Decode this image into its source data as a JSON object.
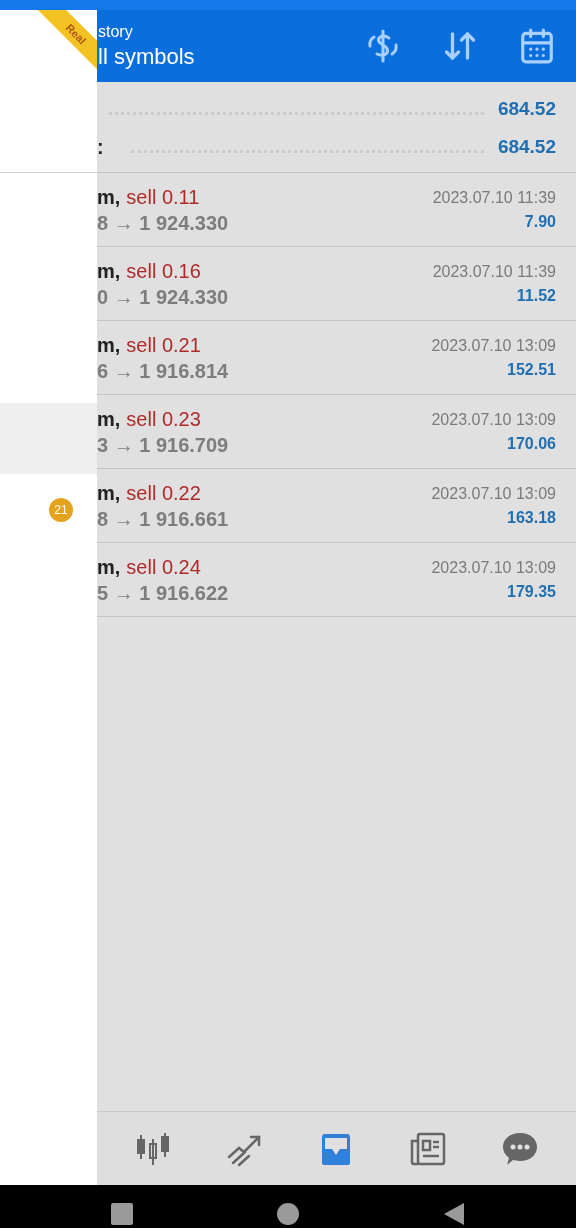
{
  "drawer": {
    "account_badge": "Real",
    "items": [
      {
        "selected": true
      },
      {
        "selected": false,
        "badge": "21"
      }
    ]
  },
  "header": {
    "title": "story",
    "subtitle": "ll symbols"
  },
  "summary": [
    {
      "value": "684.52"
    },
    {
      "label": ":",
      "value": "684.52"
    }
  ],
  "deals": [
    {
      "symbol": "m,",
      "side": "sell 0.11",
      "prices": "8 → 1 924.330",
      "time": "2023.07.10 11:39",
      "profit": "7.90"
    },
    {
      "symbol": "m,",
      "side": "sell 0.16",
      "prices": "0 → 1 924.330",
      "time": "2023.07.10 11:39",
      "profit": "11.52"
    },
    {
      "symbol": "m,",
      "side": "sell 0.21",
      "prices": "6 → 1 916.814",
      "time": "2023.07.10 13:09",
      "profit": "152.51"
    },
    {
      "symbol": "m,",
      "side": "sell 0.23",
      "prices": "3 → 1 916.709",
      "time": "2023.07.10 13:09",
      "profit": "170.06"
    },
    {
      "symbol": "m,",
      "side": "sell 0.22",
      "prices": "8 → 1 916.661",
      "time": "2023.07.10 13:09",
      "profit": "163.18"
    },
    {
      "symbol": "m,",
      "side": "sell 0.24",
      "prices": "5 → 1 916.622",
      "time": "2023.07.10 13:09",
      "profit": "179.35"
    }
  ],
  "bottom_nav": [
    {
      "kind": "quotes",
      "selected": false
    },
    {
      "kind": "chart",
      "selected": false
    },
    {
      "kind": "trade",
      "selected": true
    },
    {
      "kind": "news",
      "selected": false
    },
    {
      "kind": "chat",
      "selected": false
    }
  ]
}
